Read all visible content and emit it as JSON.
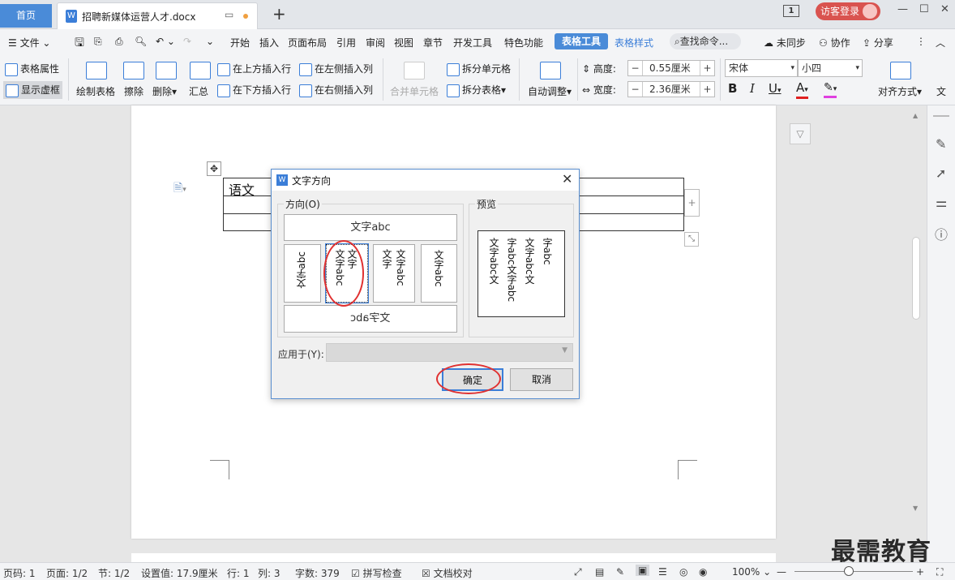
{
  "tabs": {
    "home": "首页",
    "doc_title": "招聘新媒体运营人才.docx"
  },
  "topbar": {
    "page_indicator": "1",
    "login": "访客登录"
  },
  "menu": {
    "file": "文件",
    "items": [
      "开始",
      "插入",
      "页面布局",
      "引用",
      "审阅",
      "视图",
      "章节",
      "开发工具",
      "特色功能"
    ],
    "table_tools": "表格工具",
    "table_style": "表格样式",
    "search": "查找命令...",
    "unsync": "未同步",
    "collab": "协作",
    "share": "分享"
  },
  "ribbon": {
    "table_props": "表格属性",
    "show_grid": "显示虚框",
    "draw_table": "绘制表格",
    "erase": "擦除",
    "delete": "删除",
    "summary": "汇总",
    "insert_above": "在上方插入行",
    "insert_below": "在下方插入行",
    "insert_left": "在左侧插入列",
    "insert_right": "在右侧插入列",
    "merge_cells": "合并单元格",
    "split_cells": "拆分单元格",
    "split_table": "拆分表格",
    "auto_fit": "自动调整",
    "height_label": "高度:",
    "height_value": "0.55厘米",
    "width_label": "宽度:",
    "width_value": "2.36厘米",
    "font_name": "宋体",
    "font_size": "小四",
    "align": "对齐方式",
    "text": "文"
  },
  "doc": {
    "cell_text": "语文"
  },
  "dialog": {
    "title": "文字方向",
    "direction_label": "方向(O)",
    "preview_label": "预览",
    "opt_horizontal": "文字abc",
    "opt_rot_left": "文字abc",
    "opt_vertical_a": "文字",
    "opt_vertical_b": "文字abc",
    "opt_vertical_c": "文字",
    "opt_vertical_d": "文字abc",
    "opt_rot_right": "文字abc",
    "opt_flipped": "文字abc",
    "preview_lines": [
      "字abc",
      "文字abc文",
      "字abc文字abc",
      "文字abc文"
    ],
    "apply_label": "应用于(Y):",
    "ok": "确定",
    "cancel": "取消"
  },
  "status": {
    "page": "页码: 1",
    "pages": "页面: 1/2",
    "section": "节: 1/2",
    "setting": "设置值: 17.9厘米",
    "row": "行: 1",
    "col": "列: 3",
    "words": "字数: 379",
    "spell": "拼写检查",
    "proof": "文档校对",
    "zoom": "100%"
  },
  "watermark": "最需教育"
}
